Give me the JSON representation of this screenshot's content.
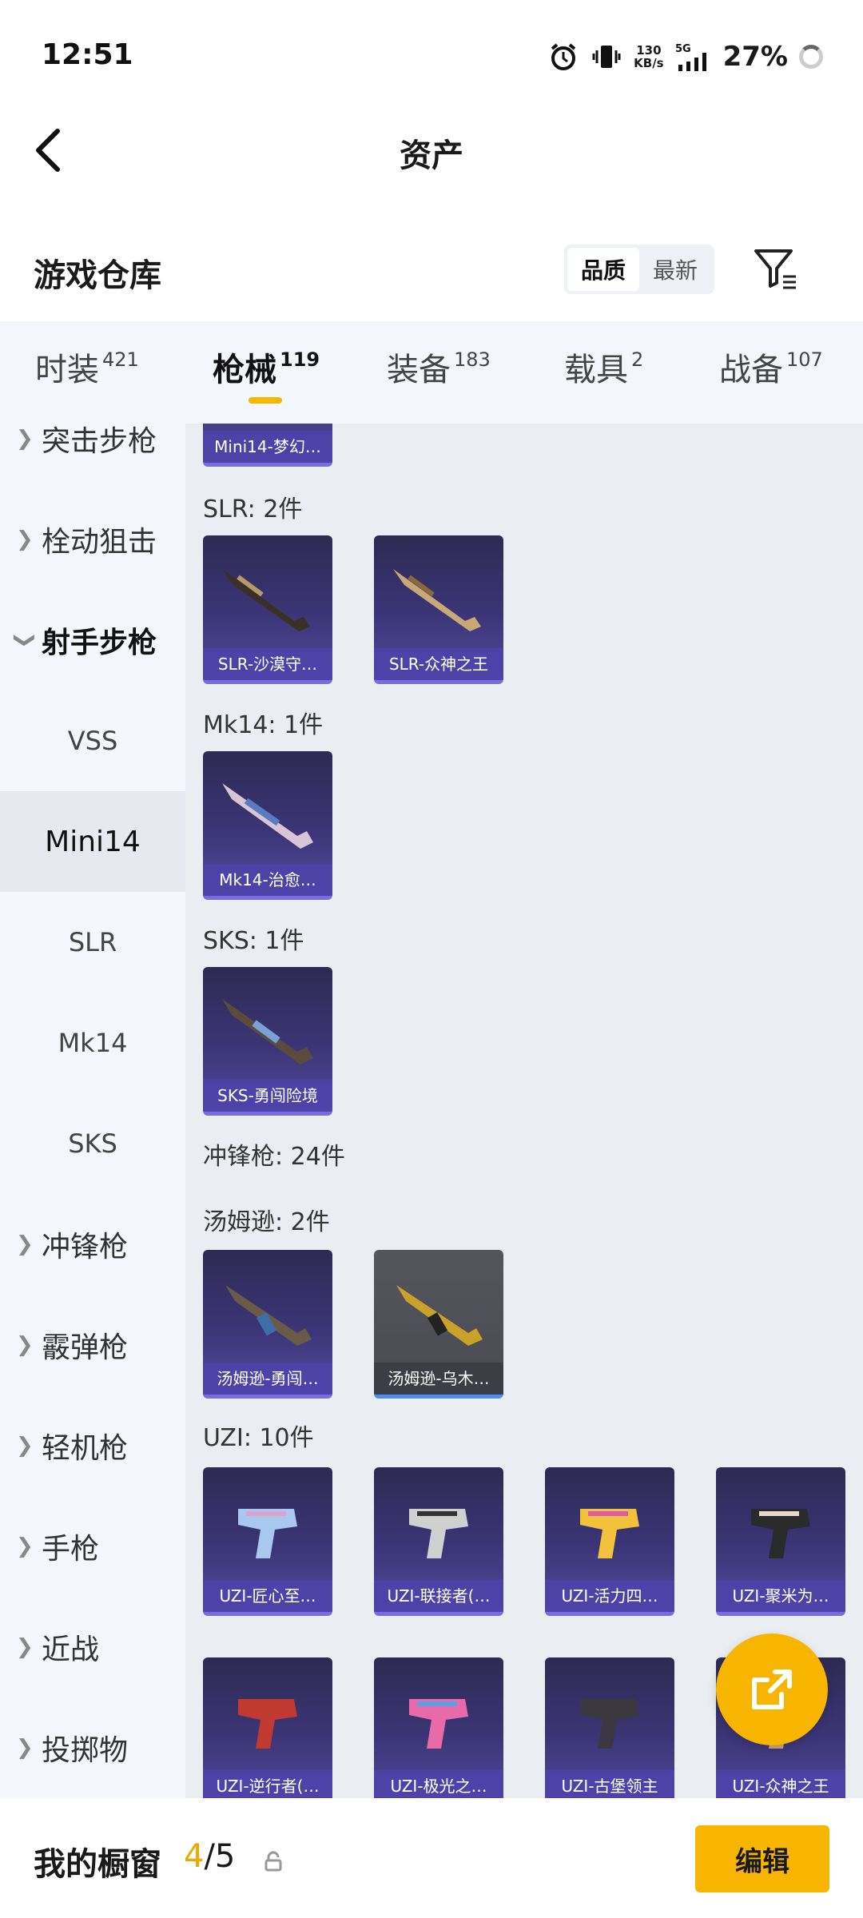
{
  "status": {
    "time": "12:51",
    "net_value": "130",
    "net_unit": "KB/s",
    "signal": "5G",
    "battery": "27%"
  },
  "header": {
    "title": "资产"
  },
  "warehouse": {
    "title": "游戏仓库",
    "sort_options": [
      "品质",
      "最新"
    ],
    "sort_selected": "品质"
  },
  "tabs": [
    {
      "label": "时装",
      "count": "421"
    },
    {
      "label": "枪械",
      "count": "119"
    },
    {
      "label": "装备",
      "count": "183"
    },
    {
      "label": "载具",
      "count": "2"
    },
    {
      "label": "战备",
      "count": "107"
    }
  ],
  "sidebar": {
    "categories": [
      "突击步枪",
      "栓动狙击",
      "射手步枪",
      "冲锋枪",
      "霰弹枪",
      "轻机枪",
      "手枪",
      "近战",
      "投掷物"
    ],
    "subitems": [
      "VSS",
      "Mini14",
      "SLR",
      "Mk14",
      "SKS"
    ],
    "selected_sub": "Mini14"
  },
  "content": {
    "partial_card": "Mini14-梦幻…",
    "sections": {
      "slr": "SLR: 2件",
      "mk14": "Mk14: 1件",
      "sks": "SKS: 1件",
      "smg": "冲锋枪: 24件",
      "thompson": "汤姆逊: 2件",
      "uzi": "UZI: 10件"
    },
    "cards": {
      "slr": [
        "SLR-沙漠守…",
        "SLR-众神之王"
      ],
      "mk14": [
        "Mk14-治愈…"
      ],
      "sks": [
        "SKS-勇闯险境"
      ],
      "thompson": [
        "汤姆逊-勇闯…",
        "汤姆逊-乌木…"
      ],
      "uzi_row1": [
        "UZI-匠心至…",
        "UZI-联接者(…",
        "UZI-活力四…",
        "UZI-聚米为…"
      ],
      "uzi_row2": [
        "UZI-逆行者(…",
        "UZI-极光之…",
        "UZI-古堡领主",
        "UZI-众神之王"
      ]
    }
  },
  "bottom": {
    "showcase_label": "我的橱窗",
    "count_current": "4",
    "count_total": "/5",
    "edit_label": "编辑"
  },
  "colors": {
    "accent": "#f7b500",
    "card_purple": "#3b3577",
    "card_border": "#7a6be0",
    "sidebar_bg": "#f4f7fb",
    "content_bg": "#eaedf2"
  }
}
